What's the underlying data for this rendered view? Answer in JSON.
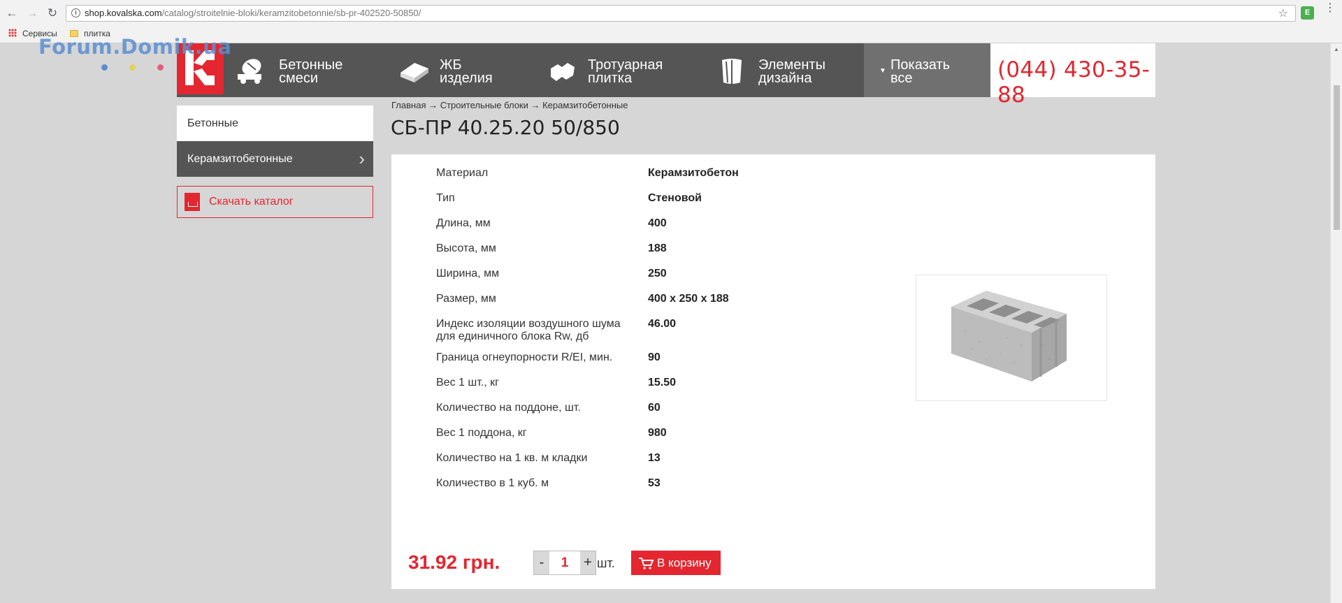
{
  "browser": {
    "url_host": "shop.kovalska.com",
    "url_path": "/catalog/stroitelnie-bloki/keramzitobetonnie/sb-pr-402520-50850/",
    "bookmarks": [
      "Сервисы",
      "плитка"
    ]
  },
  "watermark": {
    "text": "Forum.Domik.ua",
    "dot_colors": [
      "#5b8fd1",
      "#e0d15a",
      "#e06080"
    ]
  },
  "header": {
    "nav": [
      {
        "label": "Бетонные\nсмеси",
        "icon": "concrete-mixer-icon"
      },
      {
        "label": "ЖБ\nизделия",
        "icon": "concrete-slab-icon"
      },
      {
        "label": "Тротуарная\nплитка",
        "icon": "paving-tile-icon"
      },
      {
        "label": "Элементы\nдизайна",
        "icon": "design-element-icon"
      }
    ],
    "more_label": "Показать\nвсе",
    "phone": "(044) 430-35-88"
  },
  "sidebar": {
    "items": [
      {
        "label": "Бетонные",
        "active": false
      },
      {
        "label": "Керамзитобетонные",
        "active": true
      }
    ],
    "download_label": "Скачать каталог"
  },
  "breadcrumb": "Главная → Строительные блоки → Керамзитобетонные",
  "product": {
    "title": "СБ-ПР 40.25.20 50/850",
    "specs": [
      {
        "key": "Материал",
        "value": "Керамзитобетон"
      },
      {
        "key": "Тип",
        "value": "Стеновой"
      },
      {
        "key": "Длина, мм",
        "value": "400"
      },
      {
        "key": "Высота, мм",
        "value": "188"
      },
      {
        "key": "Ширина, мм",
        "value": "250"
      },
      {
        "key": "Размер, мм",
        "value": "400 x 250 x 188"
      },
      {
        "key": "Индекс изоляции воздушного шума для единичного блока Rw, дб",
        "value": "46.00"
      },
      {
        "key": "Граница огнеупорности R/EI, мин.",
        "value": "90"
      },
      {
        "key": "Вес 1 шт., кг",
        "value": "15.50"
      },
      {
        "key": "Количество на поддоне, шт.",
        "value": "60"
      },
      {
        "key": "Вес 1 поддона, кг",
        "value": "980"
      },
      {
        "key": "Количество на 1 кв. м кладки",
        "value": "13"
      },
      {
        "key": "Количество в 1 куб. м",
        "value": "53"
      }
    ],
    "price": "31.92 грн.",
    "quantity": "1",
    "minus": "-",
    "plus": "+",
    "unit": "шт.",
    "cart_label": "В корзину"
  },
  "colors": {
    "accent": "#e3262f",
    "nav_bg": "#555556",
    "page_bg": "#d6d6d6"
  }
}
